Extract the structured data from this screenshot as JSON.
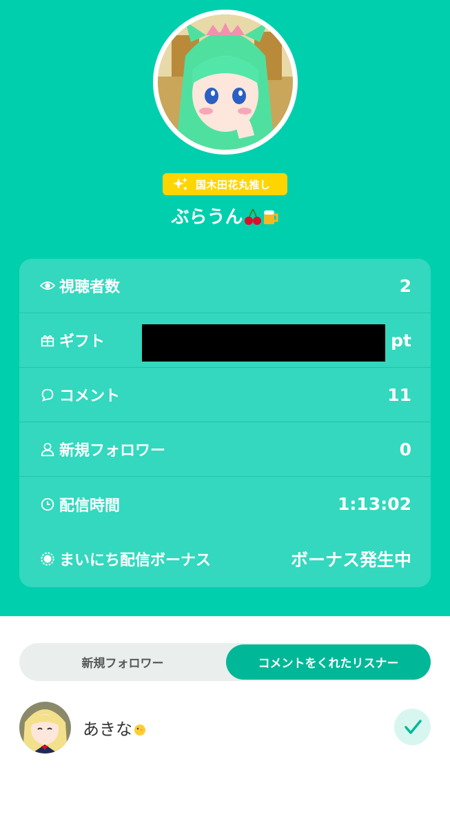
{
  "header": {
    "fan_badge": "国木田花丸推し",
    "username": "ぶらうん"
  },
  "stats": {
    "rows": [
      {
        "icon": "eye-icon",
        "label": "視聴者数",
        "value": "2"
      },
      {
        "icon": "gift-icon",
        "label": "ギフト",
        "value": "pt"
      },
      {
        "icon": "comment-icon",
        "label": "コメント",
        "value": "11"
      },
      {
        "icon": "person-icon",
        "label": "新規フォロワー",
        "value": "0"
      },
      {
        "icon": "clock-icon",
        "label": "配信時間",
        "value": "1:13:02"
      },
      {
        "icon": "bonus-icon",
        "label": "まいにち配信ボーナス",
        "value": "ボーナス発生中"
      }
    ]
  },
  "tabs": [
    {
      "label": "新規フォロワー",
      "active": false
    },
    {
      "label": "コメントをくれたリスナー",
      "active": true
    }
  ],
  "listeners": [
    {
      "name": "あきな"
    }
  ],
  "colors": {
    "hero": "#00cfae",
    "badge": "#ffd500",
    "tab_active": "#00b897",
    "check_bg": "#d8f6f0"
  }
}
